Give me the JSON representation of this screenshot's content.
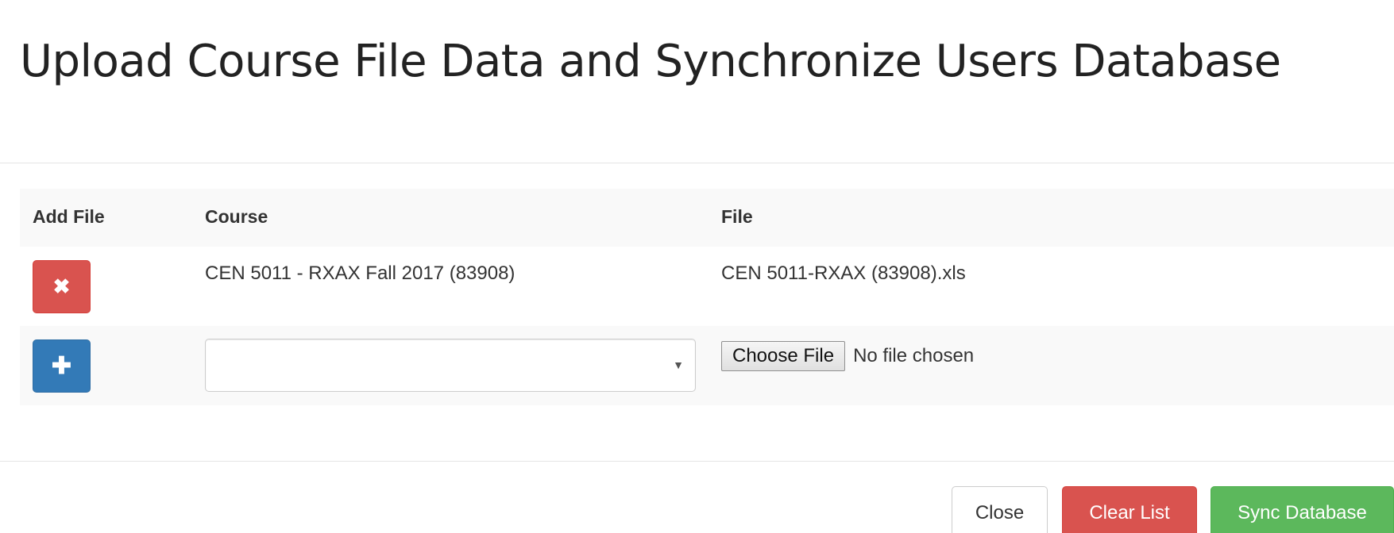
{
  "modal": {
    "title": "Upload Course File Data and Synchronize Users Database"
  },
  "table": {
    "headers": {
      "add_file": "Add File",
      "course": "Course",
      "file": "File"
    },
    "rows": [
      {
        "action_icon": "remove-icon",
        "action_symbol": "✖",
        "course": "CEN 5011 - RXAX Fall 2017 (83908)",
        "file": "CEN 5011-RXAX (83908).xls"
      }
    ],
    "new_row": {
      "action_icon": "plus-icon",
      "action_symbol": "✚",
      "course_select_value": "",
      "select_arrow": "▼",
      "choose_file_label": "Choose File",
      "file_status": "No file chosen"
    }
  },
  "footer": {
    "close_label": "Close",
    "clear_label": "Clear List",
    "sync_label": "Sync Database"
  },
  "colors": {
    "danger": "#d9534f",
    "primary": "#337ab7",
    "success": "#5cb85c"
  }
}
